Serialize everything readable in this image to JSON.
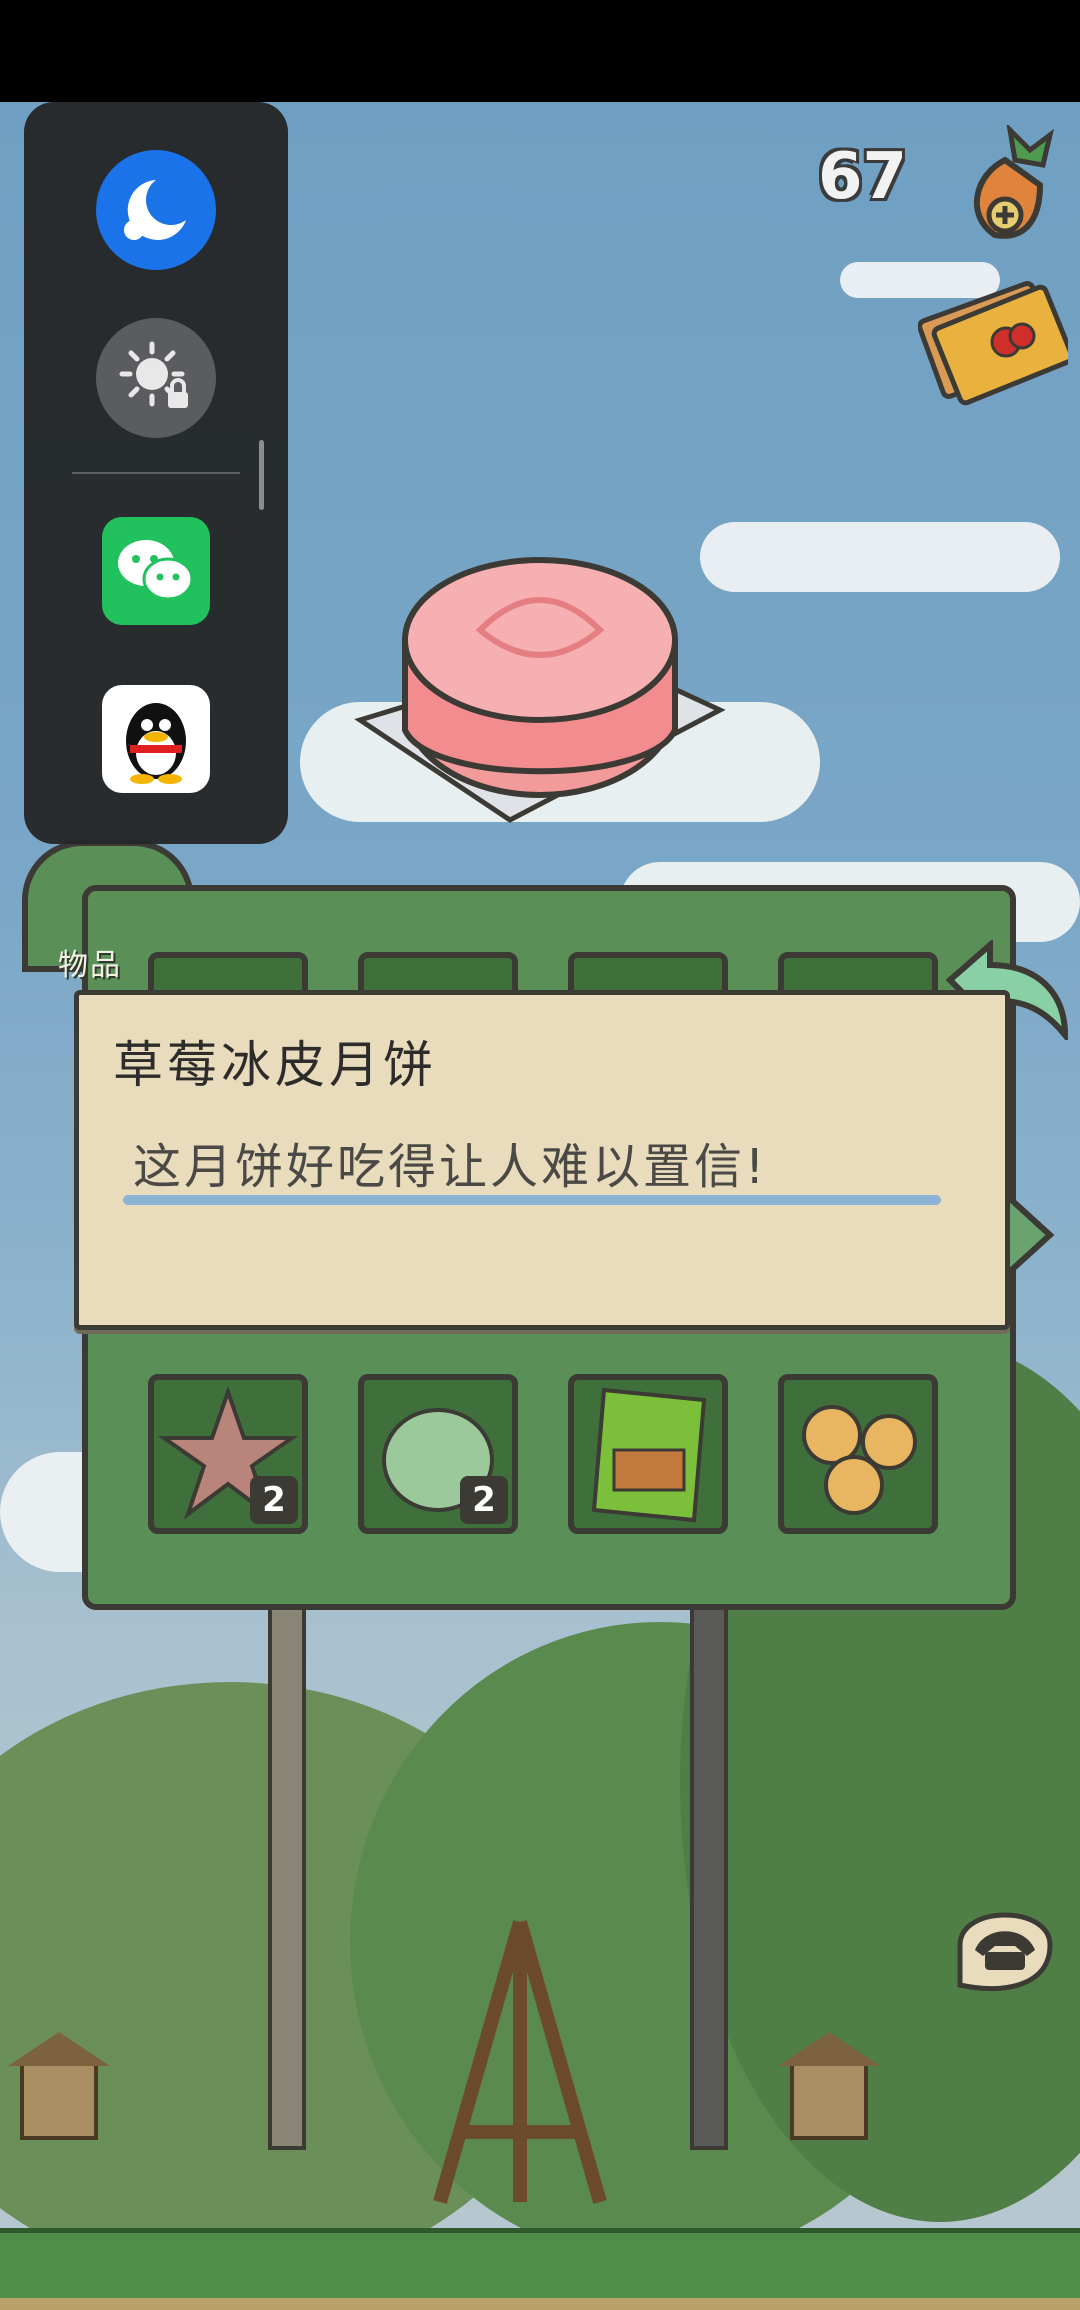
{
  "hud": {
    "carrot_count": "67",
    "carrot_icon": "carrot-add-icon",
    "ticket_icon": "lottery-ticket-icon"
  },
  "panel": {
    "tab_label": "物品",
    "back_icon": "back-arrow-icon",
    "next_icon": "next-arrow-icon",
    "slots": [
      {
        "item": "starfish",
        "count": "2"
      },
      {
        "item": "mochi-ball",
        "count": "2"
      },
      {
        "item": "snack-bag",
        "count": ""
      },
      {
        "item": "animal-cookies",
        "count": ""
      }
    ]
  },
  "item_description": {
    "title": "草莓冰皮月饼",
    "text": "这月饼好吃得让人难以置信!"
  },
  "floating_dock": {
    "buttons": [
      {
        "name": "night-mode-icon"
      },
      {
        "name": "brightness-lock-icon"
      }
    ],
    "apps": [
      {
        "name": "wechat-icon",
        "color": "#21c25e"
      },
      {
        "name": "qq-icon",
        "color": "#ffffff"
      }
    ]
  },
  "phone_button_icon": "telephone-icon"
}
